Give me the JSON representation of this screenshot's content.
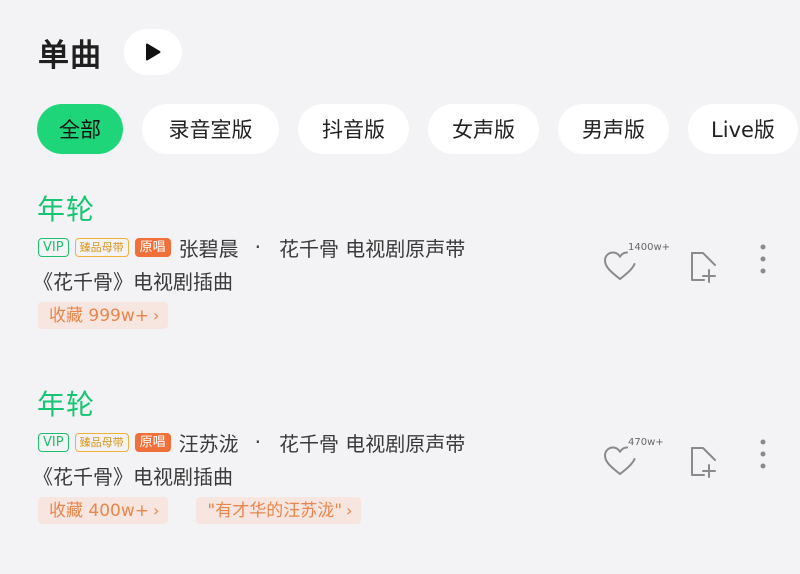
{
  "header": {
    "title": "单曲"
  },
  "filters": [
    {
      "label": "全部",
      "active": true
    },
    {
      "label": "录音室版",
      "active": false
    },
    {
      "label": "抖音版",
      "active": false
    },
    {
      "label": "女声版",
      "active": false
    },
    {
      "label": "男声版",
      "active": false
    },
    {
      "label": "Live版",
      "active": false
    }
  ],
  "songs": [
    {
      "title": "年轮",
      "badges": {
        "vip": "VIP",
        "hq": "臻品母带",
        "original": "原唱"
      },
      "artist": "张碧晨",
      "separator": "·",
      "album": "花千骨 电视剧原声带",
      "description": "《花千骨》电视剧插曲",
      "likes": "1400w+",
      "tags": [
        "收藏 999w+"
      ]
    },
    {
      "title": "年轮",
      "badges": {
        "vip": "VIP",
        "hq": "臻品母带",
        "original": "原唱"
      },
      "artist": "汪苏泷",
      "separator": "·",
      "album": "花千骨 电视剧原声带",
      "description": "《花千骨》电视剧插曲",
      "likes": "470w+",
      "tags": [
        "收藏 400w+",
        "\"有才华的汪苏泷\""
      ]
    }
  ],
  "colors": {
    "accent": "#1fd57a",
    "title_green": "#17c672",
    "tag_text": "#e8864d",
    "tag_bg": "#f7e6df",
    "original_badge": "#f1703a",
    "hq_badge": "#f0b33a"
  },
  "icons": {
    "play": "play-icon",
    "like": "heart-icon",
    "add": "add-to-playlist-icon",
    "more": "more-vertical-icon",
    "chevron": "chevron-right-icon"
  }
}
